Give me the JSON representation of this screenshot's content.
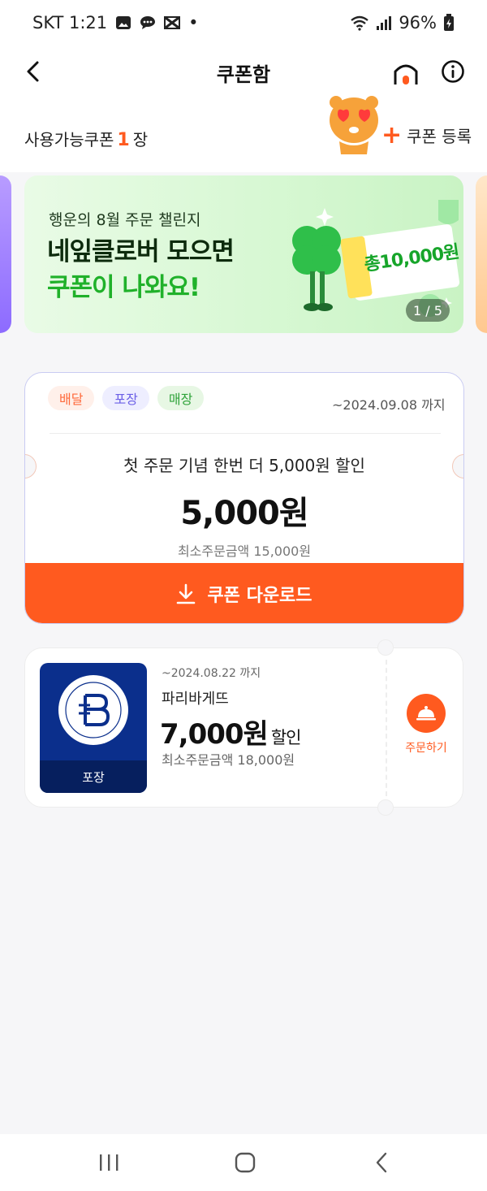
{
  "status_bar": {
    "carrier_time": "SKT 1:21",
    "dot": "•",
    "battery": "96%",
    "icons": [
      "gallery-icon",
      "chat-icon",
      "capcut-icon",
      "wifi-icon",
      "signal-icon",
      "battery-icon"
    ]
  },
  "header": {
    "title": "쿠폰함",
    "back_icon": "chevron-left-icon",
    "home_icon": "home-icon",
    "info_icon": "info-icon"
  },
  "summary": {
    "available_label": "사용가능쿠폰",
    "available_count": "1",
    "available_unit": "장",
    "register_plus": "+",
    "register_label": "쿠폰 등록"
  },
  "banner": {
    "subtitle": "행운의 8월 주문 챌린지",
    "line1": "네잎클로버 모으면",
    "line2": "쿠폰이 나와요!",
    "ticket_text": "총10,000원",
    "counter": "1 / 5",
    "colors": {
      "line2": "#20b12a"
    }
  },
  "coupon": {
    "tags": [
      "배달",
      "포장",
      "매장"
    ],
    "expiry": "~2024.09.08 까지",
    "title": "첫 주문 기념 한번 더 5,000원 할인",
    "amount": "5,000원",
    "min_order": "최소주문금액 15,000원",
    "download_label": "쿠폰 다운로드",
    "accent": "#ff5a1f"
  },
  "store_coupon": {
    "thumb_label": "포장",
    "expiry": "~2024.08.22 까지",
    "store_name": "파리바게뜨",
    "amount": "7,000원",
    "amount_suffix": "할인",
    "min_order": "최소주문금액 18,000원",
    "order_label": "주문하기"
  },
  "nav_bar": {
    "icons": [
      "recent-apps-icon",
      "home-circle-icon",
      "back-icon"
    ]
  }
}
